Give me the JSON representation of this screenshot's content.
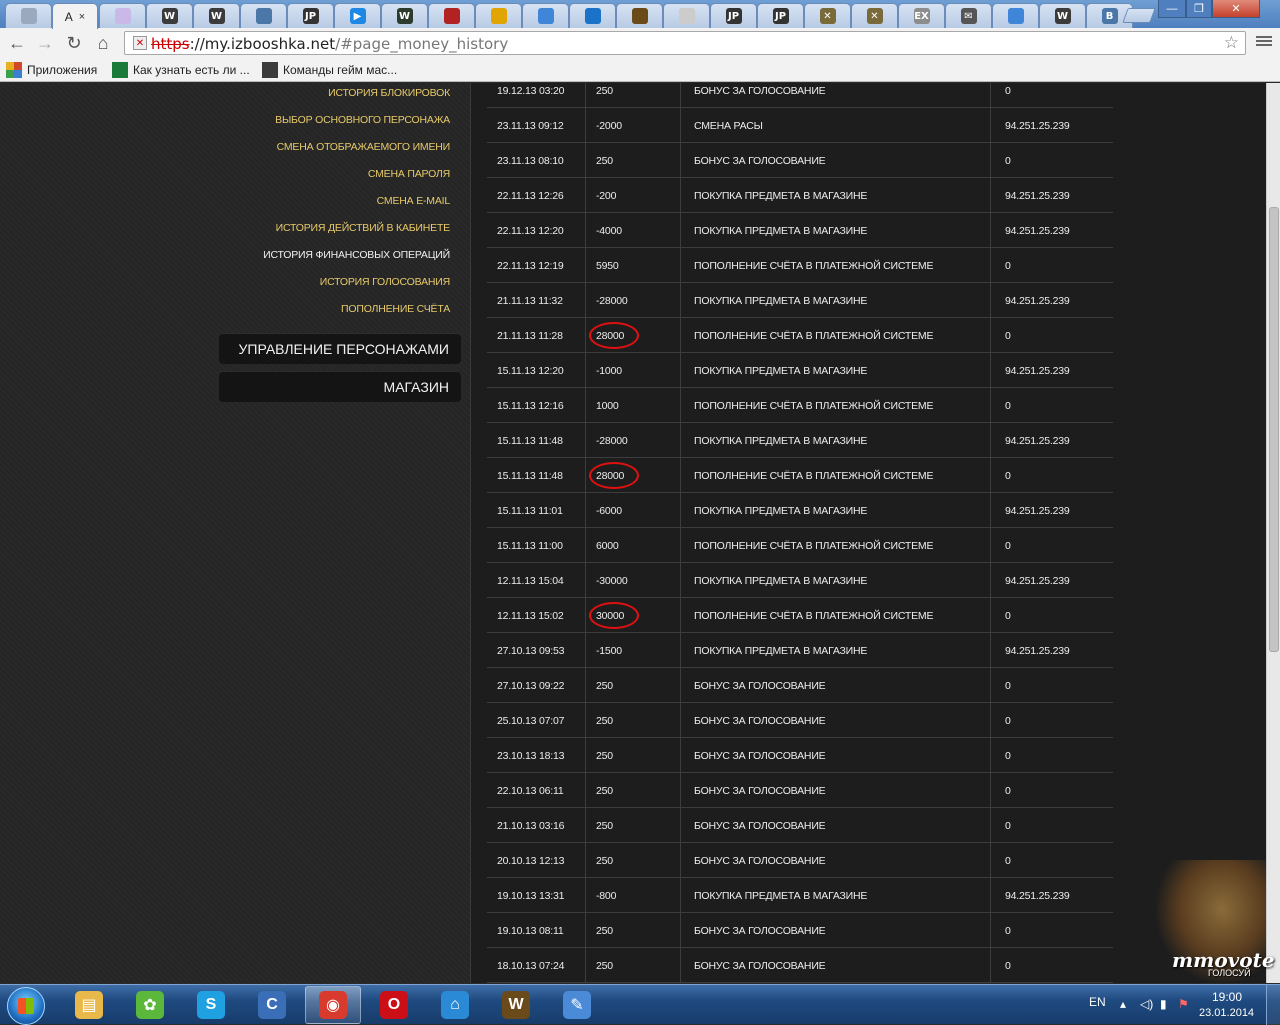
{
  "browser": {
    "active_tab_label": "A",
    "tab_close": "×",
    "tabs": [
      {
        "icon": "tab-icon-1",
        "glyph": "",
        "color": "#9aa9bd"
      },
      {
        "icon": "tab-icon-2",
        "glyph": "",
        "color": "#c9b8e8"
      },
      {
        "icon": "tab-icon-wow",
        "glyph": "W",
        "color": "#3b3b3b"
      },
      {
        "icon": "tab-icon-wow",
        "glyph": "W",
        "color": "#3b3b3b"
      },
      {
        "icon": "tab-icon-vk",
        "glyph": "",
        "color": "#4a76a8"
      },
      {
        "icon": "tab-icon-jp",
        "glyph": "JP",
        "color": "#333333"
      },
      {
        "icon": "tab-icon-play",
        "glyph": "▶",
        "color": "#1e88e5"
      },
      {
        "icon": "tab-icon-w",
        "glyph": "W",
        "color": "#2d3b2d"
      },
      {
        "icon": "tab-icon-horde",
        "glyph": "",
        "color": "#b32222"
      },
      {
        "icon": "tab-icon-flag",
        "glyph": "",
        "color": "#e2a400"
      },
      {
        "icon": "tab-icon-bird",
        "glyph": "",
        "color": "#3f86d8"
      },
      {
        "icon": "tab-icon-skype",
        "glyph": "",
        "color": "#1a73c9"
      },
      {
        "icon": "tab-icon-orb",
        "glyph": "",
        "color": "#6b4a1a"
      },
      {
        "icon": "tab-icon-page",
        "glyph": "",
        "color": "#cccccc"
      },
      {
        "icon": "tab-icon-jp",
        "glyph": "JP",
        "color": "#333333"
      },
      {
        "icon": "tab-icon-jp",
        "glyph": "JP",
        "color": "#333333"
      },
      {
        "icon": "tab-icon-x",
        "glyph": "✕",
        "color": "#7a6a3a"
      },
      {
        "icon": "tab-icon-x",
        "glyph": "✕",
        "color": "#7a6a3a"
      },
      {
        "icon": "tab-icon-ex",
        "glyph": "EX",
        "color": "#8c8c8c"
      },
      {
        "icon": "tab-icon-mail",
        "glyph": "✉",
        "color": "#555555"
      },
      {
        "icon": "tab-icon-bird",
        "glyph": "",
        "color": "#3f86d8"
      },
      {
        "icon": "tab-icon-wow",
        "glyph": "W",
        "color": "#3b3b3b"
      },
      {
        "icon": "tab-icon-vk",
        "glyph": "B",
        "color": "#4a76a8"
      }
    ],
    "url_scheme": "https",
    "url_host": "://my.izbooshka.net",
    "url_path": "/#page_money_history",
    "bookmarks": [
      {
        "label": "Приложения",
        "color": "#d04a2a"
      },
      {
        "label": "Как узнать есть ли ...",
        "color": "#1a7a3a"
      },
      {
        "label": "Команды гейм мас...",
        "color": "#3b3b3b"
      }
    ]
  },
  "sidebar": {
    "links": [
      {
        "label": "История блокировок",
        "current": false
      },
      {
        "label": "Выбор основного персонажа",
        "current": false
      },
      {
        "label": "Смена отображаемого имени",
        "current": false
      },
      {
        "label": "Смена пароля",
        "current": false
      },
      {
        "label": "Смена E-mail",
        "current": false
      },
      {
        "label": "История действий в кабинете",
        "current": false
      },
      {
        "label": "История финансовых операций",
        "current": true
      },
      {
        "label": "История голосования",
        "current": false
      },
      {
        "label": "Пополнение счёта",
        "current": false
      }
    ],
    "buttons": [
      {
        "label": "Управление персонажами"
      },
      {
        "label": "Магазин"
      }
    ]
  },
  "transactions": [
    {
      "date": "19.12.13 03:20",
      "amount": "250",
      "desc": "Бонус за голосование",
      "ip": "0",
      "circled": false
    },
    {
      "date": "23.11.13 09:12",
      "amount": "-2000",
      "desc": "Смена расы",
      "ip": "94.251.25.239",
      "circled": false
    },
    {
      "date": "23.11.13 08:10",
      "amount": "250",
      "desc": "Бонус за голосование",
      "ip": "0",
      "circled": false
    },
    {
      "date": "22.11.13 12:26",
      "amount": "-200",
      "desc": "Покупка предмета в магазине",
      "ip": "94.251.25.239",
      "circled": false
    },
    {
      "date": "22.11.13 12:20",
      "amount": "-4000",
      "desc": "Покупка предмета в магазине",
      "ip": "94.251.25.239",
      "circled": false
    },
    {
      "date": "22.11.13 12:19",
      "amount": "5950",
      "desc": "Пополнение счёта в платежной системе",
      "ip": "0",
      "circled": false
    },
    {
      "date": "21.11.13 11:32",
      "amount": "-28000",
      "desc": "Покупка предмета в магазине",
      "ip": "94.251.25.239",
      "circled": false
    },
    {
      "date": "21.11.13 11:28",
      "amount": "28000",
      "desc": "Пополнение счёта в платежной системе",
      "ip": "0",
      "circled": true
    },
    {
      "date": "15.11.13 12:20",
      "amount": "-1000",
      "desc": "Покупка предмета в магазине",
      "ip": "94.251.25.239",
      "circled": false
    },
    {
      "date": "15.11.13 12:16",
      "amount": "1000",
      "desc": "Пополнение счёта в платежной системе",
      "ip": "0",
      "circled": false
    },
    {
      "date": "15.11.13 11:48",
      "amount": "-28000",
      "desc": "Покупка предмета в магазине",
      "ip": "94.251.25.239",
      "circled": false
    },
    {
      "date": "15.11.13 11:48",
      "amount": "28000",
      "desc": "Пополнение счёта в платежной системе",
      "ip": "0",
      "circled": true
    },
    {
      "date": "15.11.13 11:01",
      "amount": "-6000",
      "desc": "Покупка предмета в магазине",
      "ip": "94.251.25.239",
      "circled": false
    },
    {
      "date": "15.11.13 11:00",
      "amount": "6000",
      "desc": "Пополнение счёта в платежной системе",
      "ip": "0",
      "circled": false
    },
    {
      "date": "12.11.13 15:04",
      "amount": "-30000",
      "desc": "Покупка предмета в магазине",
      "ip": "94.251.25.239",
      "circled": false
    },
    {
      "date": "12.11.13 15:02",
      "amount": "30000",
      "desc": "Пополнение счёта в платежной системе",
      "ip": "0",
      "circled": true
    },
    {
      "date": "27.10.13 09:53",
      "amount": "-1500",
      "desc": "Покупка предмета в магазине",
      "ip": "94.251.25.239",
      "circled": false
    },
    {
      "date": "27.10.13 09:22",
      "amount": "250",
      "desc": "Бонус за голосование",
      "ip": "0",
      "circled": false
    },
    {
      "date": "25.10.13 07:07",
      "amount": "250",
      "desc": "Бонус за голосование",
      "ip": "0",
      "circled": false
    },
    {
      "date": "23.10.13 18:13",
      "amount": "250",
      "desc": "Бонус за голосование",
      "ip": "0",
      "circled": false
    },
    {
      "date": "22.10.13 06:11",
      "amount": "250",
      "desc": "Бонус за голосование",
      "ip": "0",
      "circled": false
    },
    {
      "date": "21.10.13 03:16",
      "amount": "250",
      "desc": "Бонус за голосование",
      "ip": "0",
      "circled": false
    },
    {
      "date": "20.10.13 12:13",
      "amount": "250",
      "desc": "Бонус за голосование",
      "ip": "0",
      "circled": false
    },
    {
      "date": "19.10.13 13:31",
      "amount": "-800",
      "desc": "Покупка предмета в магазине",
      "ip": "94.251.25.239",
      "circled": false
    },
    {
      "date": "19.10.13 08:11",
      "amount": "250",
      "desc": "Бонус за голосование",
      "ip": "0",
      "circled": false
    },
    {
      "date": "18.10.13 07:24",
      "amount": "250",
      "desc": "Бонус за голосование",
      "ip": "0",
      "circled": false
    }
  ],
  "widget": {
    "logo": "mmovote",
    "subtitle": "голосуй"
  },
  "taskbar": {
    "apps": [
      {
        "name": "explorer-icon",
        "glyph": "▤",
        "color": "#e8b84a",
        "active": false
      },
      {
        "name": "icq-icon",
        "glyph": "✿",
        "color": "#5cb83a",
        "active": false
      },
      {
        "name": "skype-icon",
        "glyph": "S",
        "color": "#1fa0e0",
        "active": false
      },
      {
        "name": "app-c-icon",
        "glyph": "C",
        "color": "#3a6fb8",
        "active": false
      },
      {
        "name": "chrome-icon",
        "glyph": "◉",
        "color": "#d93a2e",
        "active": true
      },
      {
        "name": "opera-icon",
        "glyph": "O",
        "color": "#cc0f16",
        "active": false
      },
      {
        "name": "home-app-icon",
        "glyph": "⌂",
        "color": "#2a8ad6",
        "active": false
      },
      {
        "name": "wow-icon",
        "glyph": "W",
        "color": "#6a4a1a",
        "active": false
      },
      {
        "name": "paint-icon",
        "glyph": "✎",
        "color": "#4a8ad6",
        "active": false
      }
    ],
    "lang": "EN",
    "time": "19:00",
    "date": "23.01.2014"
  }
}
